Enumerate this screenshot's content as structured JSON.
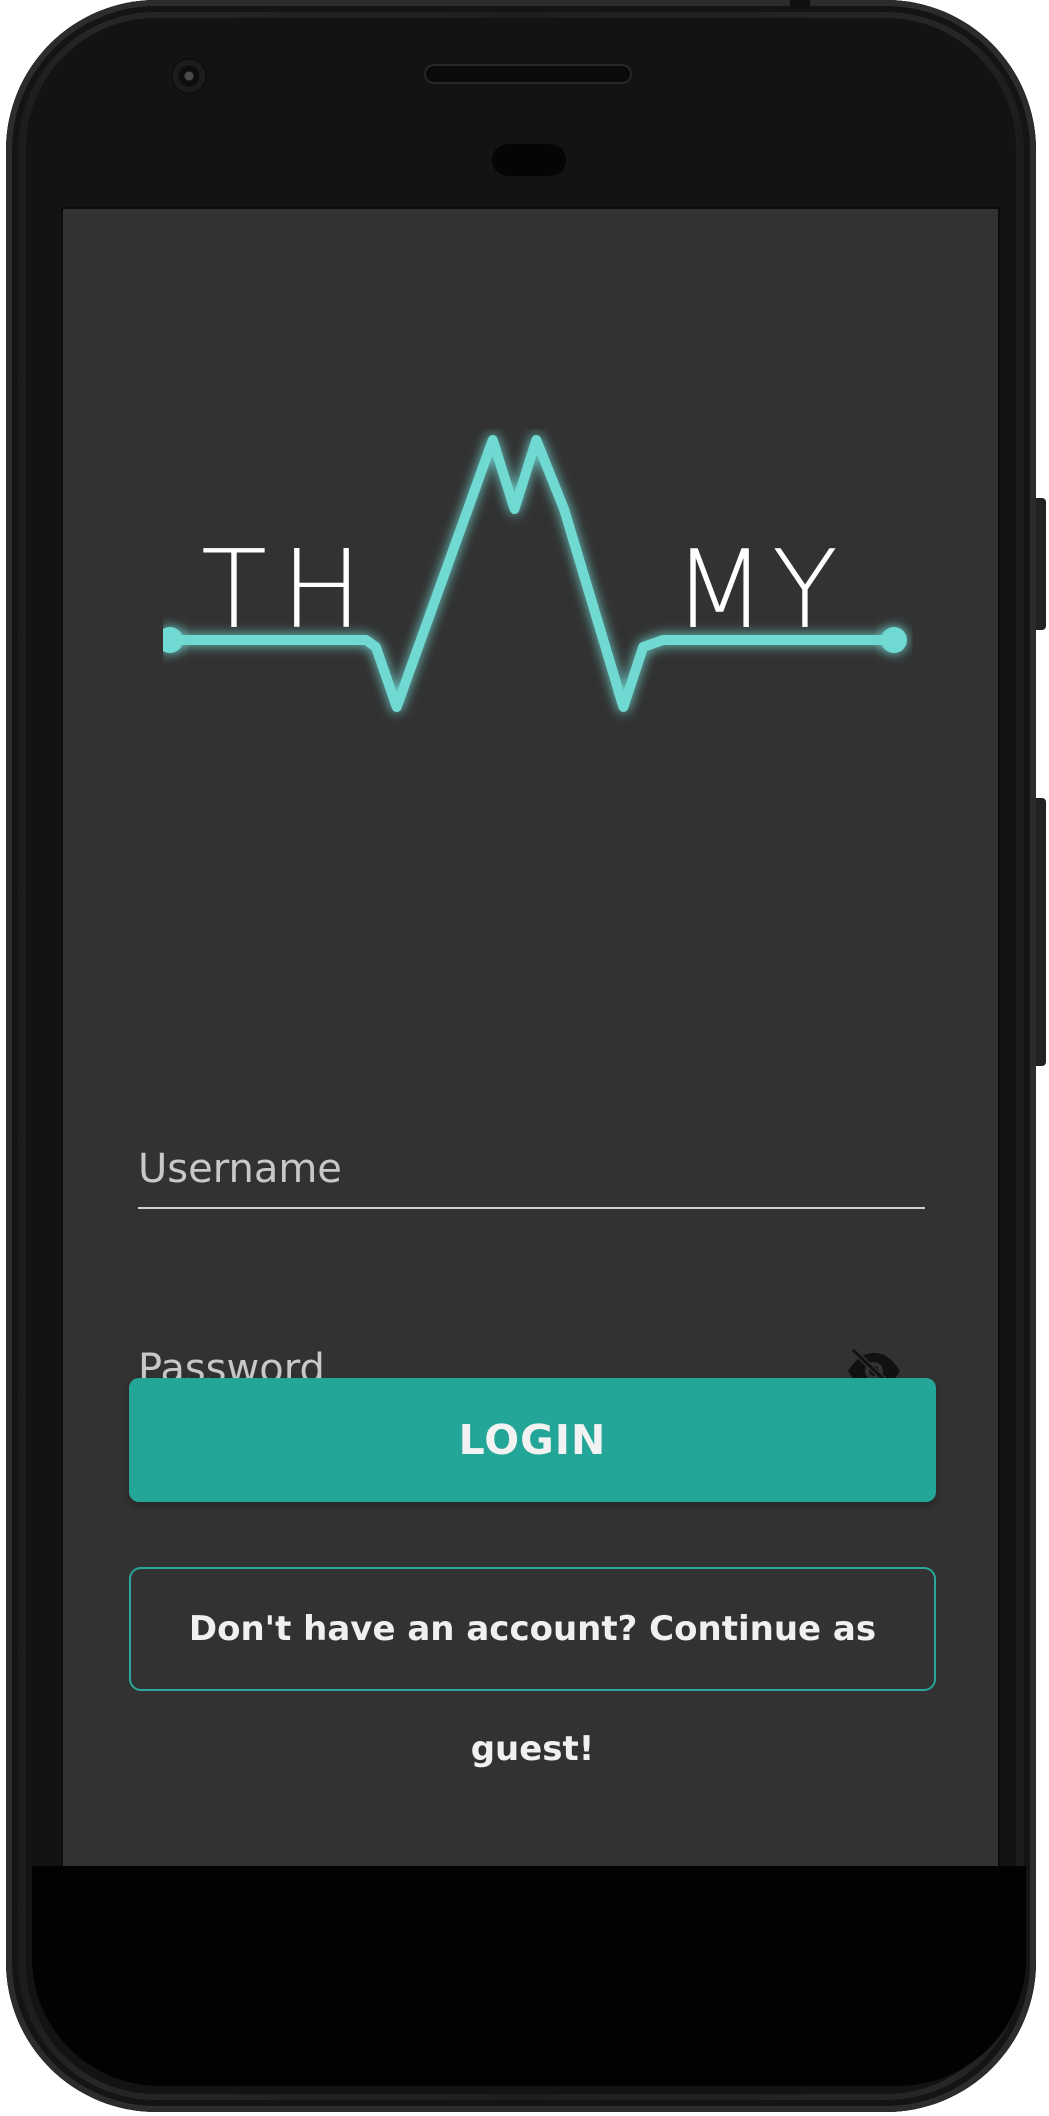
{
  "app": {
    "logo_text_left": [
      "T",
      "H"
    ],
    "logo_text_right": [
      "M",
      "Y"
    ],
    "accent_color": "#6fd9d2",
    "button_color": "#23a598"
  },
  "form": {
    "username_label": "Username",
    "password_label": "Password",
    "password_visibility_icon": "eye-off-icon"
  },
  "actions": {
    "login_label": "LOGIN",
    "guest_label": "Don't have an account? Continue as guest!"
  }
}
